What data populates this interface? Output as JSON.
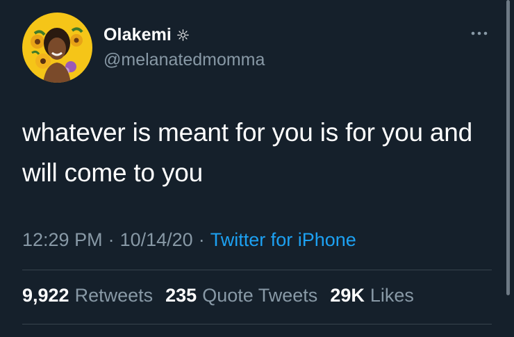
{
  "user": {
    "display_name": "Olakemi",
    "badge_icon": "sun-icon",
    "handle": "@melanatedmomma",
    "avatar_bg": "#f5c518"
  },
  "tweet": {
    "text": "whatever is meant for you is for you and will come to you",
    "time": "12:29 PM",
    "separator": "·",
    "date": "10/14/20",
    "source": "Twitter for iPhone"
  },
  "stats": [
    {
      "count": "9,922",
      "label": "Retweets"
    },
    {
      "count": "235",
      "label": "Quote Tweets"
    },
    {
      "count": "29K",
      "label": "Likes"
    }
  ],
  "colors": {
    "background": "#15202b",
    "secondary_text": "#8899a6",
    "link": "#1da1f2",
    "divider": "#38444d"
  }
}
